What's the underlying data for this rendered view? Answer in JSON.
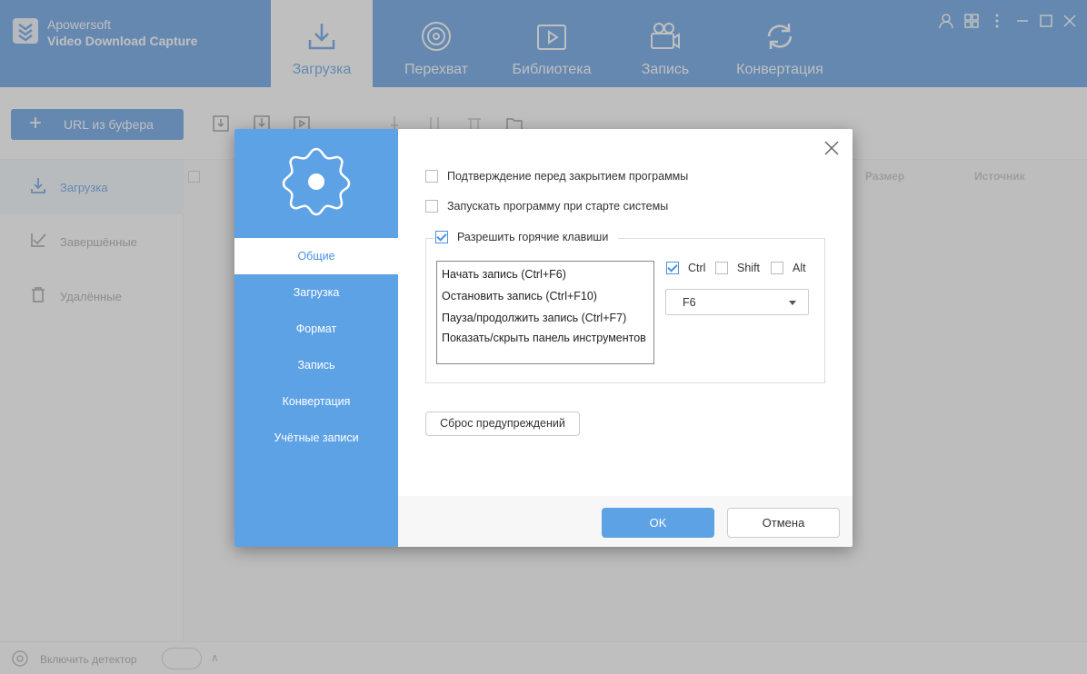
{
  "app": {
    "name_line1": "Apowersoft",
    "name_line2": "Video Download Capture",
    "brand_color": "#4a90e2"
  },
  "nav_tabs": [
    {
      "label": "Загрузка",
      "icon": "download-icon",
      "active": true
    },
    {
      "label": "Перехват",
      "icon": "target-icon",
      "active": false
    },
    {
      "label": "Библиотека",
      "icon": "library-icon",
      "active": false
    },
    {
      "label": "Запись",
      "icon": "video-camera-icon",
      "active": false
    },
    {
      "label": "Конвертация",
      "icon": "convert-icon",
      "active": false
    }
  ],
  "toolbar": {
    "url_button_label": "URL из буфера"
  },
  "sidebar": {
    "items": [
      {
        "label": "Загрузка",
        "icon": "download-icon",
        "active": true
      },
      {
        "label": "Завершённые",
        "icon": "checkmark-icon",
        "active": false
      },
      {
        "label": "Удалённые",
        "icon": "trash-icon",
        "active": false
      }
    ]
  },
  "list_columns": {
    "size": "Размер",
    "source": "Источник"
  },
  "statusbar": {
    "detector_label": "Включить детектор"
  },
  "dialog": {
    "nav": [
      {
        "label": "Общие",
        "active": true
      },
      {
        "label": "Загрузка",
        "active": false
      },
      {
        "label": "Формат",
        "active": false
      },
      {
        "label": "Запись",
        "active": false
      },
      {
        "label": "Конвертация",
        "active": false
      },
      {
        "label": "Учётные записи",
        "active": false
      }
    ],
    "options": {
      "confirm_exit": {
        "label": "Подтверждение перед закрытием программы",
        "checked": false
      },
      "autostart": {
        "label": "Запускать программу при старте системы",
        "checked": false
      },
      "hotkeys": {
        "label": "Разрешить горячие клавиши",
        "checked": true
      }
    },
    "hotkey_list": [
      "Начать запись (Ctrl+F6)",
      "Остановить запись (Ctrl+F10)",
      "Пауза/продолжить запись (Ctrl+F7)",
      "Показать/скрыть панель инструментов"
    ],
    "modifiers": {
      "ctrl": {
        "label": "Ctrl",
        "checked": true
      },
      "shift": {
        "label": "Shift",
        "checked": false
      },
      "alt": {
        "label": "Alt",
        "checked": false
      }
    },
    "key_select": {
      "value": "F6"
    },
    "reset_button": "Сброс предупреждений",
    "ok_button": "OK",
    "cancel_button": "Отмена"
  }
}
